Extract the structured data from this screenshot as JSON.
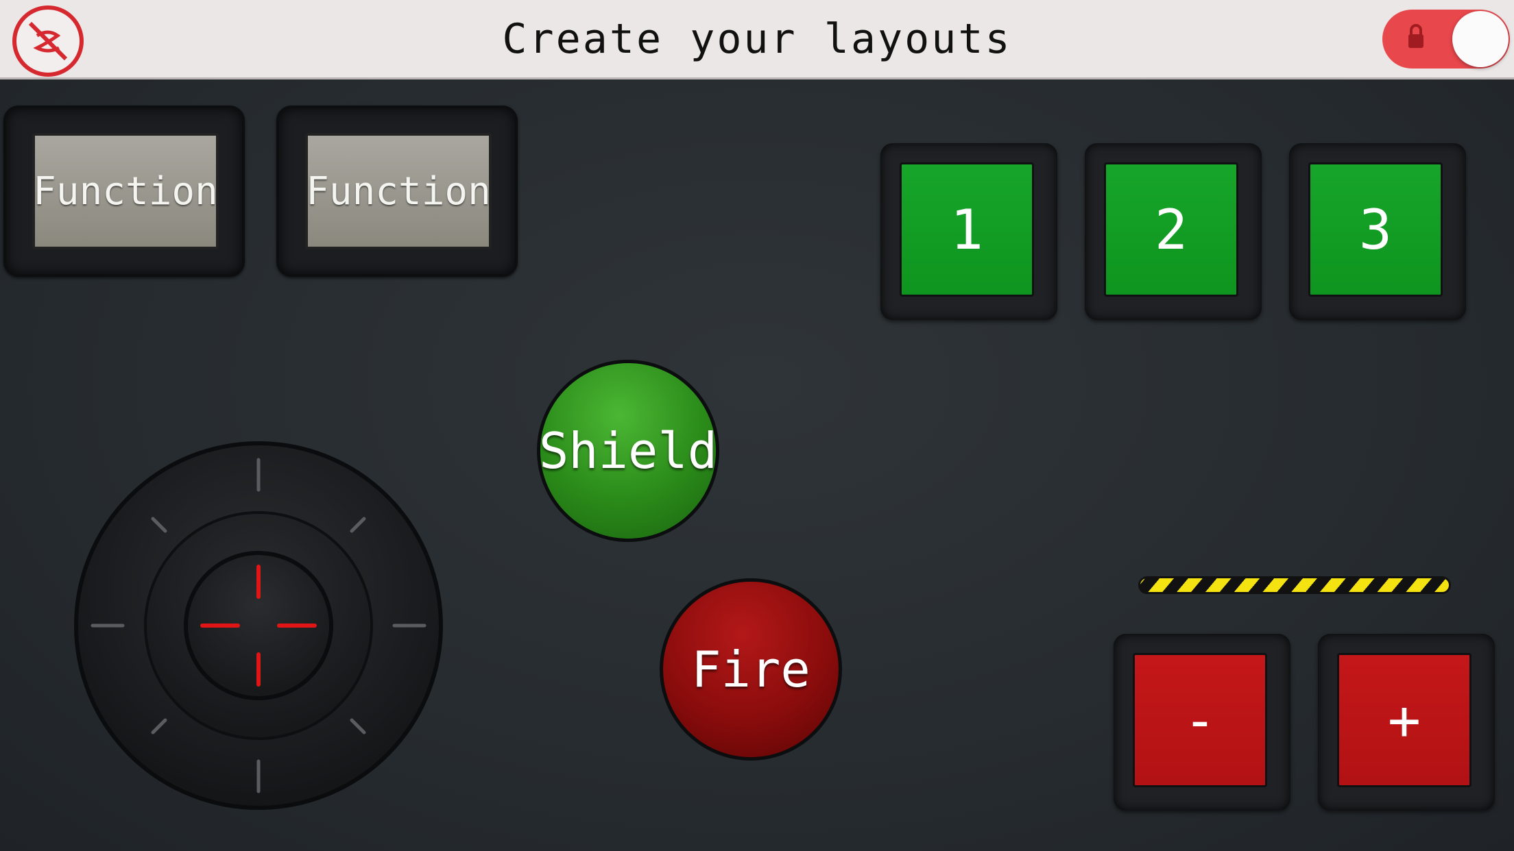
{
  "header": {
    "title": "Create your layouts",
    "logo_icon": "no-edit-icon",
    "lock_toggle": {
      "icon": "lock-icon",
      "state": "on",
      "color": "#e8474c"
    }
  },
  "function_buttons": [
    {
      "label": "Function"
    },
    {
      "label": "Function"
    }
  ],
  "number_buttons": [
    {
      "label": "1"
    },
    {
      "label": "2"
    },
    {
      "label": "3"
    }
  ],
  "action_buttons": {
    "shield": {
      "label": "Shield",
      "color": "#2a8a19"
    },
    "fire": {
      "label": "Fire",
      "color": "#8a0c0c"
    }
  },
  "adjust_buttons": [
    {
      "label": "-"
    },
    {
      "label": "+"
    }
  ],
  "joystick": {
    "icon": "dpad-joystick-icon",
    "crosshair_color": "#e01515"
  },
  "colors": {
    "background": "#2a2f33",
    "header": "#ebe7e6",
    "green_button": "#129e24",
    "red_button": "#bb1416",
    "hazard": "#f5e311"
  }
}
